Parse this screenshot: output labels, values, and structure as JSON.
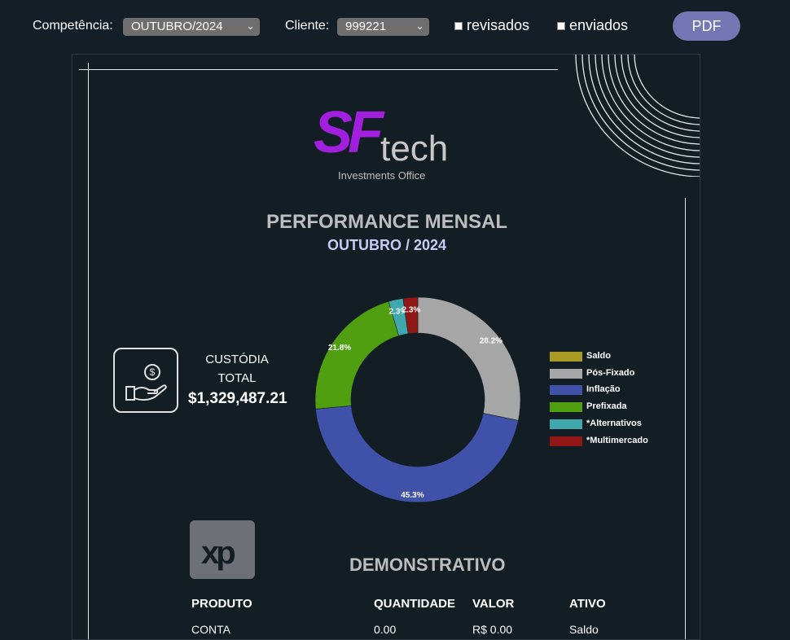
{
  "toolbar": {
    "competencia_label": "Competência:",
    "competencia_value": "OUTUBRO/2024",
    "cliente_label": "Cliente:",
    "cliente_value": "999221",
    "revisados_label": "revisados",
    "enviados_label": "enviados",
    "pdf_label": "PDF"
  },
  "report": {
    "logo": {
      "brand_sf": "SF",
      "brand_tech": "tech",
      "tagline": "Investments Office"
    },
    "title": "PERFORMANCE MENSAL",
    "subtitle": "OUTUBRO / 2024",
    "custodia": {
      "label_line1": "CUSTÓDIA",
      "label_line2": "TOTAL",
      "value": "$1,329,487.21"
    },
    "demonstrativo": {
      "title": "DEMONSTRATIVO",
      "headers": [
        "PRODUTO",
        "QUANTIDADE",
        "VALOR",
        "ATIVO"
      ],
      "rows": [
        [
          "CONTA",
          "0.00",
          "R$ 0.00",
          "Saldo"
        ]
      ]
    },
    "xp_logo": "xp"
  },
  "chart_data": {
    "type": "pie",
    "donut": true,
    "categories": [
      "Saldo",
      "Pós-Fixado",
      "Inflação",
      "Prefixada",
      "*Alternativos",
      "*Multimercado"
    ],
    "values": [
      0,
      28.2,
      45.3,
      21.8,
      2.3,
      2.3
    ],
    "labels": [
      "",
      "28.2%",
      "45.3%",
      "21.8%",
      "2.3%",
      "2.3%"
    ],
    "colors": [
      "#a89a22",
      "#a6a6a6",
      "#3f51a8",
      "#4f9f10",
      "#3fa8ac",
      "#911616"
    ],
    "legend_position": "right"
  }
}
